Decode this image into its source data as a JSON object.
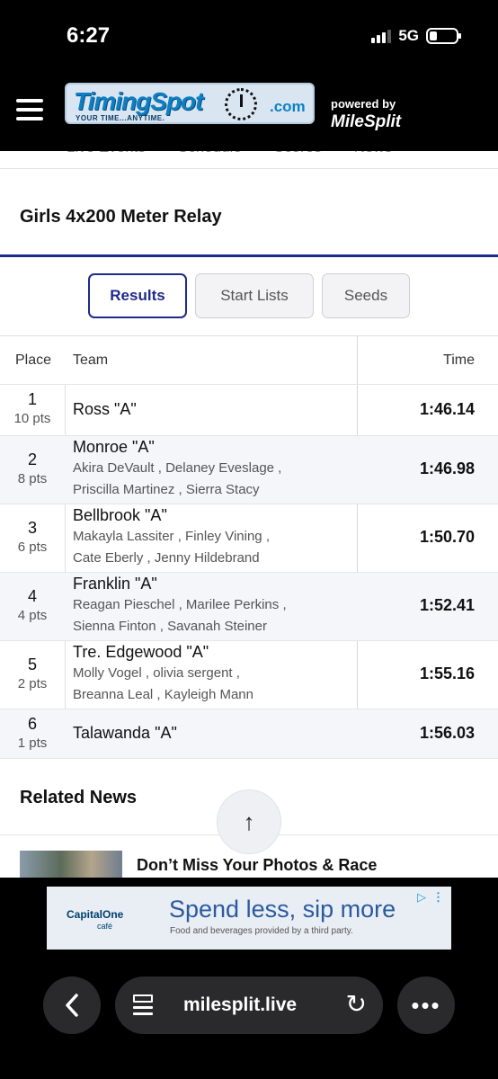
{
  "status_bar": {
    "time": "6:27",
    "network": "5G"
  },
  "header": {
    "logo_name": "TimingSpot",
    "logo_domain": ".com",
    "logo_tagline": "YOUR TIME...ANYTIME.",
    "powered_by": "powered by",
    "powered_brand": "MileSplit"
  },
  "subnav": {
    "items": [
      "Live Events",
      "Schedule",
      "Scores",
      "News"
    ]
  },
  "event": {
    "title": "Girls 4x200 Meter Relay"
  },
  "tabs": [
    {
      "label": "Results",
      "active": true
    },
    {
      "label": "Start Lists",
      "active": false
    },
    {
      "label": "Seeds",
      "active": false
    }
  ],
  "table": {
    "headers": {
      "place": "Place",
      "team": "Team",
      "time": "Time"
    },
    "rows": [
      {
        "place": "1",
        "pts": "10 pts",
        "team": "Ross \"A\"",
        "members": [],
        "time": "1:46.14"
      },
      {
        "place": "2",
        "pts": "8 pts",
        "team": "Monroe \"A\"",
        "members": [
          "Akira DeVault ,  Delaney Eveslage ,",
          "Priscilla Martinez ,  Sierra Stacy"
        ],
        "time": "1:46.98"
      },
      {
        "place": "3",
        "pts": "6 pts",
        "team": "Bellbrook \"A\"",
        "members": [
          "Makayla Lassiter ,  Finley Vining ,",
          "Cate Eberly ,  Jenny Hildebrand"
        ],
        "time": "1:50.70"
      },
      {
        "place": "4",
        "pts": "4 pts",
        "team": "Franklin \"A\"",
        "members": [
          "Reagan Pieschel ,  Marilee Perkins ,",
          "Sienna Finton ,  Savanah Steiner"
        ],
        "time": "1:52.41"
      },
      {
        "place": "5",
        "pts": "2 pts",
        "team": "Tre. Edgewood \"A\"",
        "members": [
          "Molly Vogel ,  olivia sergent ,",
          "Breanna Leal ,  Kayleigh Mann"
        ],
        "time": "1:55.16"
      },
      {
        "place": "6",
        "pts": "1 pts",
        "team": "Talawanda \"A\"",
        "members": [],
        "time": "1:56.03"
      }
    ]
  },
  "related": {
    "heading": "Related News",
    "first_title": "Don’t Miss Your Photos & Race"
  },
  "scroll_top_icon": "↑",
  "ad": {
    "brand": "CapitalOne",
    "brand_sub": "café",
    "headline": "Spend less, sip more",
    "sub": "Food and beverages provided by a third party."
  },
  "browser": {
    "url": "milesplit.live"
  }
}
